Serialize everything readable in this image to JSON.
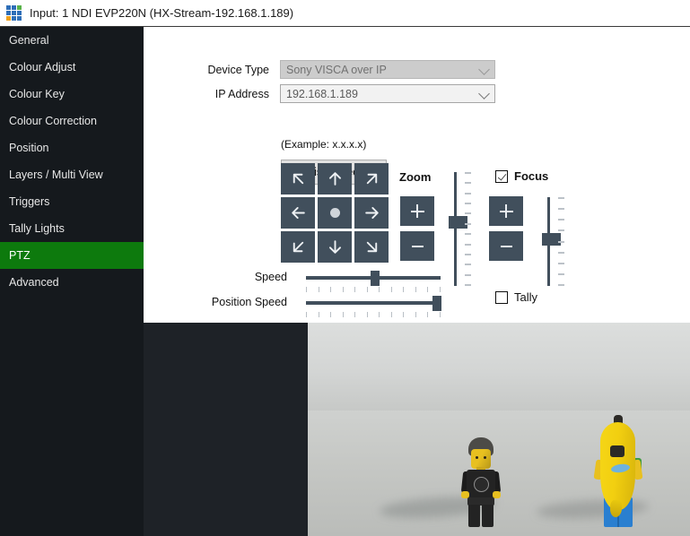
{
  "titlebar": {
    "icon": "app-grid-icon",
    "title": "Input: 1 NDI EVP220N (HX-Stream-192.168.1.189)"
  },
  "sidebar": {
    "items": [
      {
        "label": "General",
        "active": false
      },
      {
        "label": "Colour Adjust",
        "active": false
      },
      {
        "label": "Colour Key",
        "active": false
      },
      {
        "label": "Colour Correction",
        "active": false
      },
      {
        "label": "Position",
        "active": false
      },
      {
        "label": "Layers / Multi View",
        "active": false
      },
      {
        "label": "Triggers",
        "active": false
      },
      {
        "label": "Tally Lights",
        "active": false
      },
      {
        "label": "PTZ",
        "active": true
      },
      {
        "label": "Advanced",
        "active": false
      }
    ],
    "active_color": "#0d7a0d",
    "background": "#15191d"
  },
  "form": {
    "device_type": {
      "label": "Device Type",
      "value": "Sony VISCA over IP",
      "disabled": true
    },
    "ip_address": {
      "label": "IP Address",
      "value": "192.168.1.189",
      "placeholder": "192.168.1.189"
    },
    "example_note": "(Example: x.x.x.x)",
    "disconnect_button": "Disconnect"
  },
  "dpad": {
    "buttons": [
      {
        "name": "pan-up-left",
        "icon": "arrow-up-left-icon"
      },
      {
        "name": "pan-up",
        "icon": "arrow-up-icon"
      },
      {
        "name": "pan-up-right",
        "icon": "arrow-up-right-icon"
      },
      {
        "name": "pan-left",
        "icon": "arrow-left-icon"
      },
      {
        "name": "pan-home",
        "icon": "dot-icon"
      },
      {
        "name": "pan-right",
        "icon": "arrow-right-icon"
      },
      {
        "name": "pan-down-left",
        "icon": "arrow-down-left-icon"
      },
      {
        "name": "pan-down",
        "icon": "arrow-down-icon"
      },
      {
        "name": "pan-down-right",
        "icon": "arrow-down-right-icon"
      }
    ],
    "button_color": "#414f5c"
  },
  "zoom": {
    "title": "Zoom",
    "plus_label": "+",
    "minus_label": "-",
    "slider_value": 50,
    "slider_ticks": 12
  },
  "focus": {
    "title": "Focus",
    "checked": true,
    "plus_label": "+",
    "minus_label": "-",
    "slider_value": 47,
    "slider_ticks": 9
  },
  "speed": {
    "label": "Speed",
    "value": 51,
    "ticks": 12
  },
  "position_speed": {
    "label": "Position Speed",
    "value": 97,
    "ticks": 12
  },
  "tally": {
    "label": "Tally",
    "checked": false
  },
  "preview": {
    "name": "ndi-video-preview",
    "description": "Live NDI video preview showing two LEGO minifigures on a light grey surface",
    "background": "#1e2227"
  }
}
